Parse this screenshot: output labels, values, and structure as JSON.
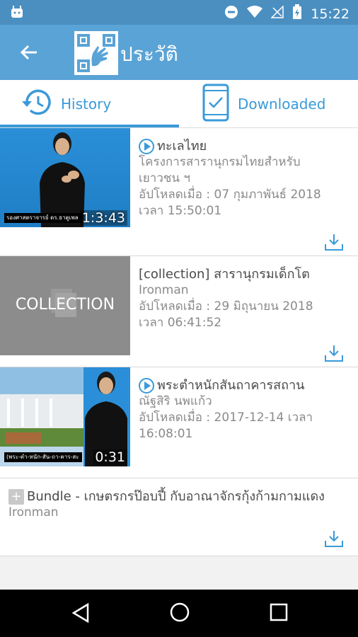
{
  "status_bar": {
    "time": "15:22"
  },
  "app_bar": {
    "title": "ประวัติ"
  },
  "tabs": [
    {
      "label": "History"
    },
    {
      "label": "Downloaded"
    }
  ],
  "items": [
    {
      "title": "ทะเลไทย",
      "line2": "โครงการสารานุกรมไทยสำหรับ",
      "line3": "เยาวชน ฯ",
      "upload": "อัปโหลดเมื่อ : 07 กุมภาพันธ์ 2018",
      "time": "เวลา 15:50:01",
      "duration": "1:3:43",
      "caption": "รองศาสตราจารย์ ดร.ธาตูเพล"
    },
    {
      "title": "[collection] สารานุกรมเด็กโต",
      "line2": "Ironman",
      "upload": "อัปโหลดเมื่อ : 29 มิถุนายน 2018",
      "time": "เวลา 06:41:52",
      "thumb_label": "COLLECTION"
    },
    {
      "title": "พระตำหนักสันถาคารสถาน",
      "line2": "ณัฐสิริ นพแก้ว",
      "upload": "อัปโหลดเมื่อ : 2017-12-14 เวลา",
      "time": "16:08:01",
      "duration": "0:31",
      "caption": "(พระ-ตำ-หนัก-สัน-ถา-คาร-สะ"
    },
    {
      "title": "Bundle - เกษตรกรป๊อบปี้ กับอาณาจักรกุ้งก้ามกามแดง",
      "line2": "Ironman"
    }
  ],
  "colors": {
    "status": "#4b8fc1",
    "appbar": "#5aa3d6",
    "accent": "#3a9ad9"
  }
}
